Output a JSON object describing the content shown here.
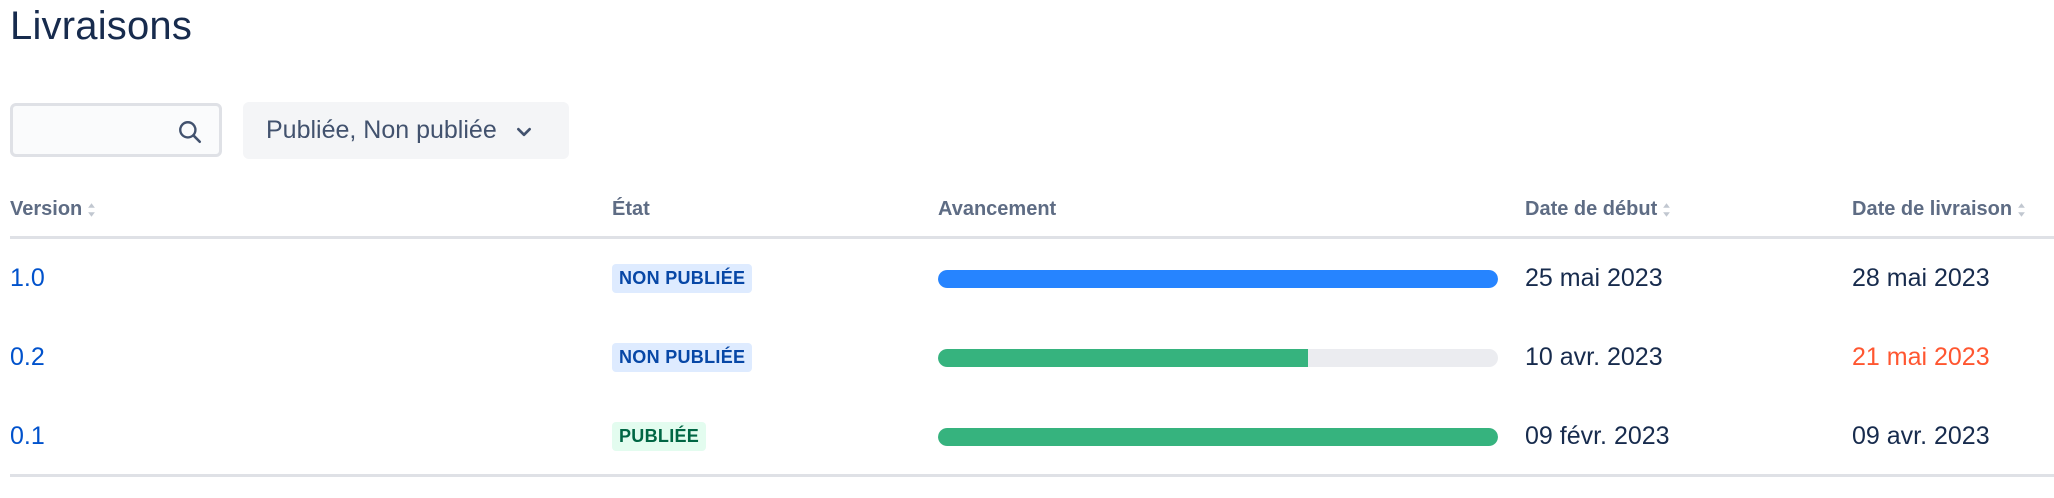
{
  "page": {
    "title": "Livraisons"
  },
  "search": {
    "value": "",
    "placeholder": "",
    "icon": "search-icon"
  },
  "filter": {
    "label": "Publiée, Non publiée",
    "icon": "chevron-down-icon"
  },
  "table": {
    "columns": {
      "version": "Version",
      "status": "État",
      "progress": "Avancement",
      "start_date": "Date de début",
      "release_date": "Date de livraison"
    },
    "rows": [
      {
        "version": "1.0",
        "status": "NON PUBLIÉE",
        "status_kind": "unreleased",
        "progress_fraction": 1.0,
        "progress_color": "#2684ff",
        "start_date": "25 mai 2023",
        "release_date": "28 mai 2023",
        "release_overdue": false
      },
      {
        "version": "0.2",
        "status": "NON PUBLIÉE",
        "status_kind": "unreleased",
        "progress_fraction": 0.66,
        "progress_color": "#36b37e",
        "start_date": "10 avr. 2023",
        "release_date": "21 mai 2023",
        "release_overdue": true
      },
      {
        "version": "0.1",
        "status": "PUBLIÉE",
        "status_kind": "released",
        "progress_fraction": 1.0,
        "progress_color": "#36b37e",
        "start_date": "09 févr. 2023",
        "release_date": "09 avr. 2023",
        "release_overdue": false
      }
    ]
  },
  "colors": {
    "link": "#0052cc",
    "overdue": "#ff5630",
    "unreleased_bg": "#deebff",
    "released_bg": "#e3fcef",
    "track": "#ebecf0"
  }
}
